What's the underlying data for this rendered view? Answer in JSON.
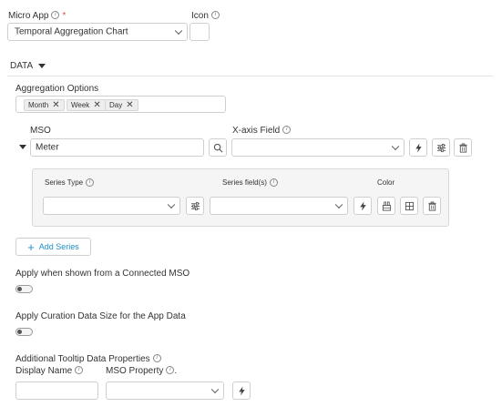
{
  "micro_app": {
    "label": "Micro App",
    "value": "Temporal Aggregation Chart"
  },
  "icon_field": {
    "label": "Icon"
  },
  "data_section": {
    "label": "DATA"
  },
  "aggregation": {
    "label": "Aggregation Options",
    "chips": [
      "Month",
      "Week",
      "Day"
    ]
  },
  "mso": {
    "label": "MSO",
    "value": "Meter"
  },
  "xaxis": {
    "label": "X-axis Field",
    "value": ""
  },
  "series": {
    "type_label": "Series Type",
    "fields_label": "Series field(s)",
    "color_label": "Color"
  },
  "add_series": {
    "label": "Add Series"
  },
  "connected_mso": {
    "label": "Apply when shown from a Connected MSO",
    "enabled": false
  },
  "curation": {
    "label": "Apply Curation Data Size for the App Data",
    "enabled": false
  },
  "tooltip": {
    "label": "Additional Tooltip Data Properties",
    "display_name_label": "Display Name",
    "mso_property_label": "MSO Property",
    "mso_property_suffix": "."
  },
  "icons": {
    "search": "search-icon",
    "bolt": "bolt-icon",
    "sliders": "sliders-icon",
    "trash": "trash-icon",
    "palette": "palette-icon",
    "grid": "grid-icon",
    "plus": "plus-icon"
  },
  "colors": {
    "accent": "#1e90c8",
    "required": "#d9534f"
  }
}
